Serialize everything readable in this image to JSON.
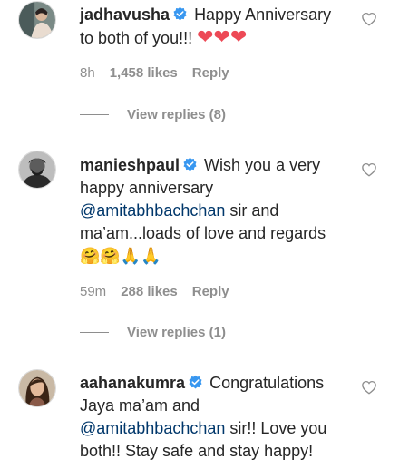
{
  "comments": [
    {
      "username": "jadhavusha",
      "text_lines": [
        "Happy Anniversary",
        "to both of you!!!"
      ],
      "emojis": [
        "❤",
        "❤",
        "❤"
      ],
      "time": "8h",
      "likes": "1,458 likes",
      "reply_label": "Reply",
      "view_replies": "View replies (8)"
    },
    {
      "username": "manieshpaul",
      "text_lines": [
        "Wish you a very",
        "happy anniversary",
        "@amitabhbachchan",
        "sir and",
        "ma’am...loads of love and regards"
      ],
      "emojis": [
        "🤗",
        "🤗",
        "🙏",
        "🙏"
      ],
      "time": "59m",
      "likes": "288 likes",
      "reply_label": "Reply",
      "view_replies": "View replies (1)"
    },
    {
      "username": "aahanakumra",
      "text_lines": [
        "Congratulations",
        "Jaya ma’am and",
        "@amitabhbachchan",
        "sir!! Love you",
        "both!! Stay safe and stay happy!"
      ]
    }
  ],
  "colors": {
    "text": "#262626",
    "muted": "#8e8e8e",
    "mention": "#00376b",
    "verified": "#3897f0",
    "heart_emoji": "#ed4956"
  },
  "icons": [
    "verified-badge-icon",
    "heart-outline-icon",
    "avatar"
  ]
}
